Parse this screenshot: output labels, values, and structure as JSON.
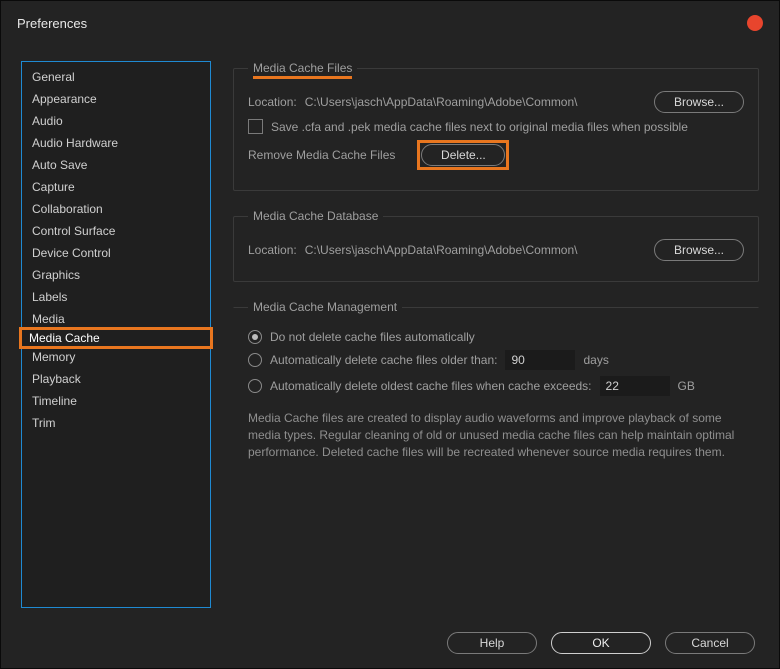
{
  "window": {
    "title": "Preferences"
  },
  "sidebar": {
    "items": [
      {
        "label": "General"
      },
      {
        "label": "Appearance"
      },
      {
        "label": "Audio"
      },
      {
        "label": "Audio Hardware"
      },
      {
        "label": "Auto Save"
      },
      {
        "label": "Capture"
      },
      {
        "label": "Collaboration"
      },
      {
        "label": "Control Surface"
      },
      {
        "label": "Device Control"
      },
      {
        "label": "Graphics"
      },
      {
        "label": "Labels"
      },
      {
        "label": "Media"
      },
      {
        "label": "Media Cache"
      },
      {
        "label": "Memory"
      },
      {
        "label": "Playback"
      },
      {
        "label": "Timeline"
      },
      {
        "label": "Trim"
      }
    ],
    "selected_index": 12
  },
  "cache_files": {
    "legend": "Media Cache Files",
    "location_label": "Location:",
    "location_path": "C:\\Users\\jasch\\AppData\\Roaming\\Adobe\\Common\\",
    "browse": "Browse...",
    "save_next_to": "Save .cfa and .pek media cache files next to original media files when possible",
    "remove_label": "Remove Media Cache Files",
    "delete": "Delete..."
  },
  "cache_db": {
    "legend": "Media Cache Database",
    "location_label": "Location:",
    "location_path": "C:\\Users\\jasch\\AppData\\Roaming\\Adobe\\Common\\",
    "browse": "Browse..."
  },
  "cache_mgmt": {
    "legend": "Media Cache Management",
    "opt_none": "Do not delete cache files automatically",
    "opt_age": "Automatically delete cache files older than:",
    "age_value": "90",
    "age_unit": "days",
    "opt_size": "Automatically delete oldest cache files when cache exceeds:",
    "size_value": "22",
    "size_unit": "GB",
    "selected": 0,
    "description": "Media Cache files are created to display audio waveforms and improve playback of some media types.  Regular cleaning of old or unused media cache files can help maintain optimal performance. Deleted cache files will be recreated whenever source media requires them."
  },
  "footer": {
    "help": "Help",
    "ok": "OK",
    "cancel": "Cancel"
  }
}
